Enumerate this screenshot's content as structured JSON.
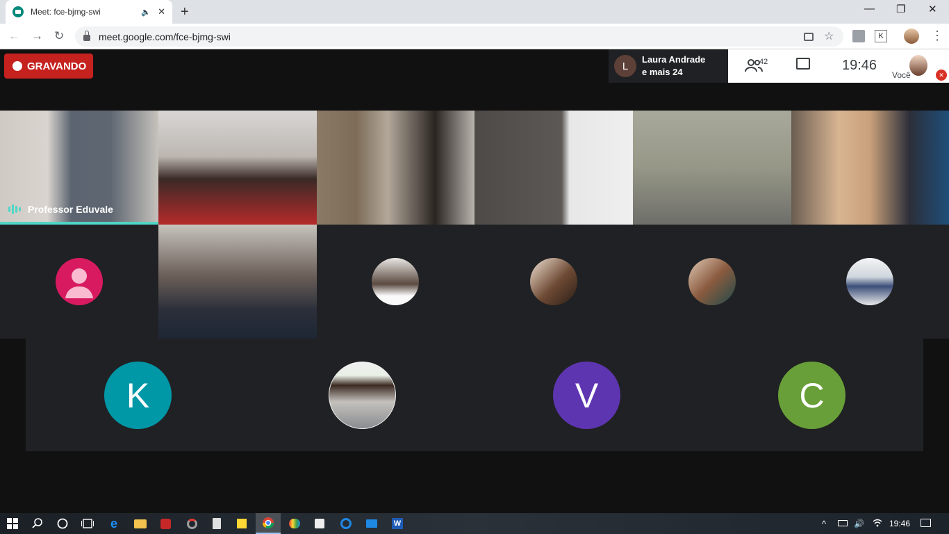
{
  "browser": {
    "tab_title": "Meet: fce-bjmg-swi",
    "url": "meet.google.com/fce-bjmg-swi",
    "new_tab": "+",
    "back": "←",
    "forward": "→",
    "reload": "↻",
    "minimize": "—",
    "restore": "❐",
    "close": "✕",
    "tab_close": "✕",
    "audio": "🔈",
    "star": "☆",
    "ext_k": "K",
    "menu": "⋮"
  },
  "meet": {
    "recording_label": "GRAVANDO",
    "presenter_initial": "L",
    "presenter_line1": "Laura Andrade",
    "presenter_line2": "e mais 24",
    "people_count": "42",
    "clock": "19:46",
    "you_label": "Você",
    "speaker_name": "Professor Eduvale",
    "letter_avatars": [
      {
        "letter": "K",
        "color": "#0097a7"
      },
      {
        "letter": "V",
        "color": "#5e35b1"
      },
      {
        "letter": "C",
        "color": "#689f38"
      }
    ],
    "colors": {
      "accent_speaking": "#4fd6c7",
      "recording": "#c5221f",
      "tile_bg": "#202124"
    }
  },
  "taskbar": {
    "time": "19:46",
    "icons": [
      "windows-start-icon",
      "search-icon",
      "cortana-icon",
      "task-view-icon",
      "edge-icon",
      "file-explorer-icon",
      "power-app-icon",
      "app-icon",
      "calculator-icon",
      "sticky-notes-icon",
      "chrome-icon",
      "paint-icon",
      "store-icon",
      "browser-icon",
      "mail-icon",
      "word-icon"
    ]
  }
}
